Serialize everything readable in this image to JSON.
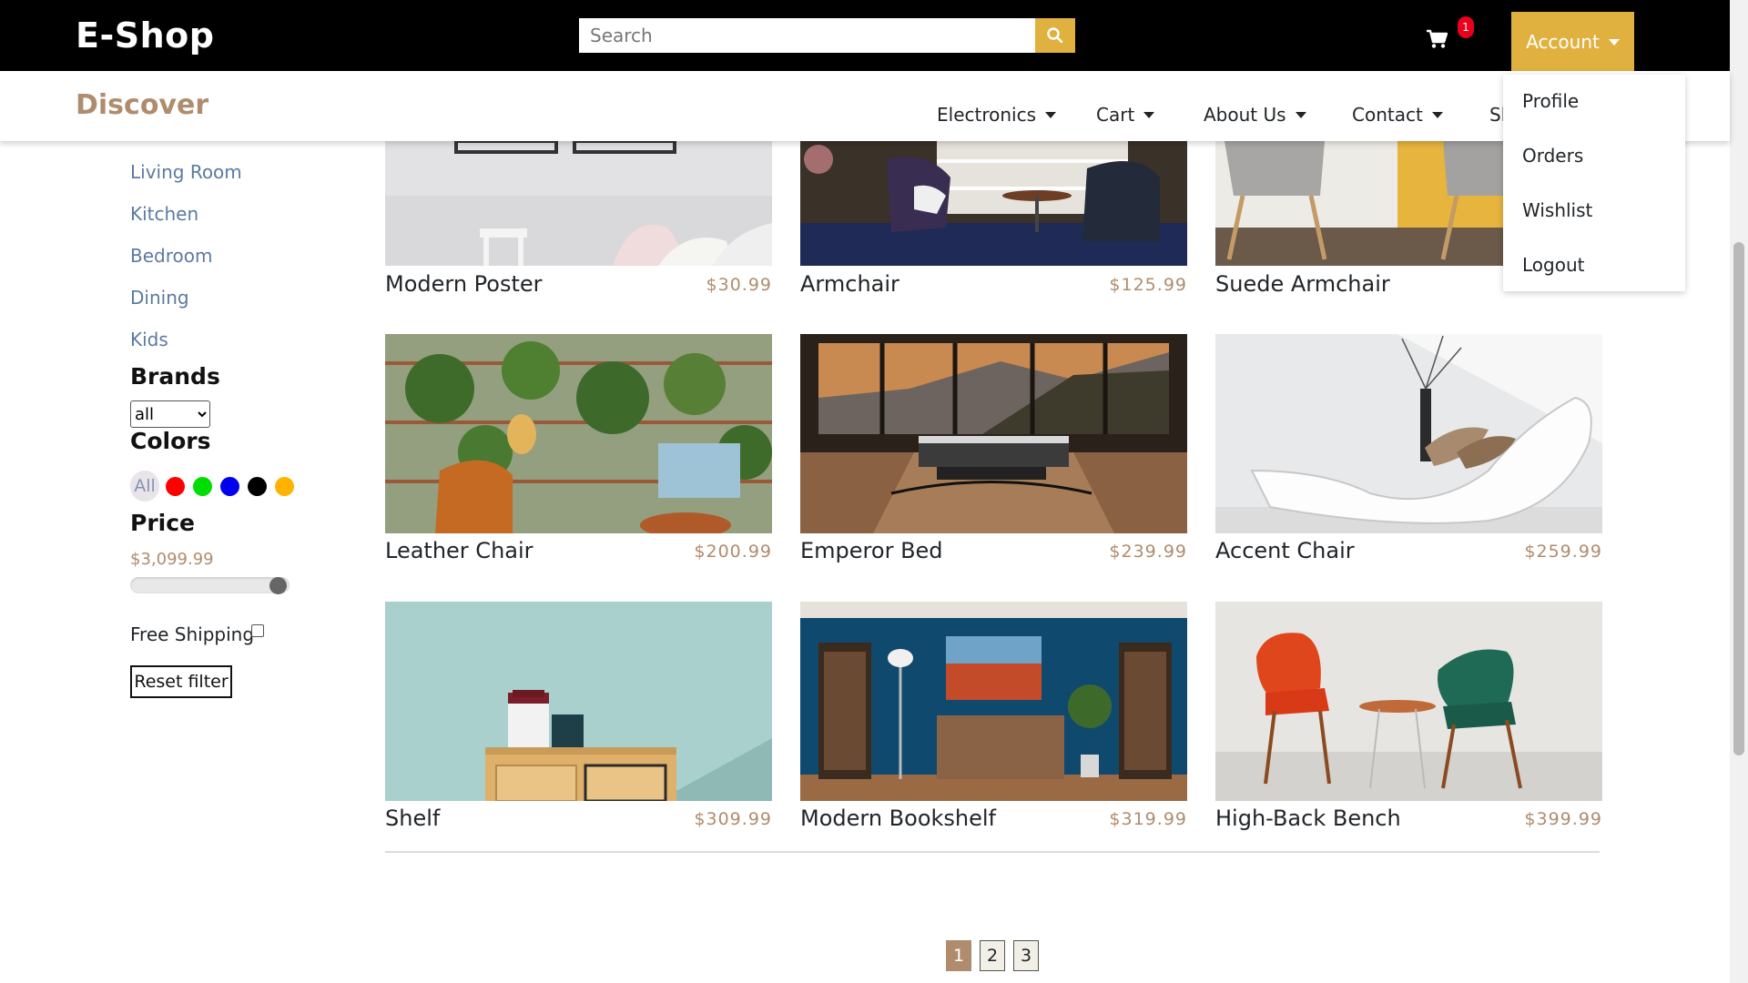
{
  "header": {
    "brand": "E-Shop",
    "search_placeholder": "Search",
    "cart_count": "1",
    "account_label": "Account"
  },
  "subnav": {
    "discover": "Discover",
    "items": [
      {
        "label": "Electronics"
      },
      {
        "label": "Cart"
      },
      {
        "label": "About Us"
      },
      {
        "label": "Contact"
      },
      {
        "label": "Sh"
      }
    ]
  },
  "account_menu": [
    "Profile",
    "Orders",
    "Wishlist",
    "Logout"
  ],
  "sidebar": {
    "categories": [
      "Living Room",
      "Kitchen",
      "Bedroom",
      "Dining",
      "Kids"
    ],
    "brands_heading": "Brands",
    "brand_selected": "all",
    "colors_heading": "Colors",
    "colors_all": "All",
    "colors": [
      "#ff0000",
      "#00dd00",
      "#0000ee",
      "#000000",
      "#ffb300"
    ],
    "price_heading": "Price",
    "price_value": "$3,099.99",
    "price_slider_fraction": 1.0,
    "free_shipping_label": "Free Shipping",
    "reset_label": "Reset filter"
  },
  "products": [
    {
      "name": "Modern Poster",
      "price": "$30.99"
    },
    {
      "name": "Armchair",
      "price": "$125.99"
    },
    {
      "name": "Suede Armchair",
      "price": ""
    },
    {
      "name": "Leather Chair",
      "price": "$200.99"
    },
    {
      "name": "Emperor Bed",
      "price": "$239.99"
    },
    {
      "name": "Accent Chair",
      "price": "$259.99"
    },
    {
      "name": "Shelf",
      "price": "$309.99"
    },
    {
      "name": "Modern Bookshelf",
      "price": "$319.99"
    },
    {
      "name": "High-Back Bench",
      "price": "$399.99"
    }
  ],
  "pagination": [
    "1",
    "2",
    "3"
  ],
  "colors": {
    "accent": "#e0b13e",
    "brand_brown": "#b08c6e",
    "badge": "#e8001c"
  }
}
